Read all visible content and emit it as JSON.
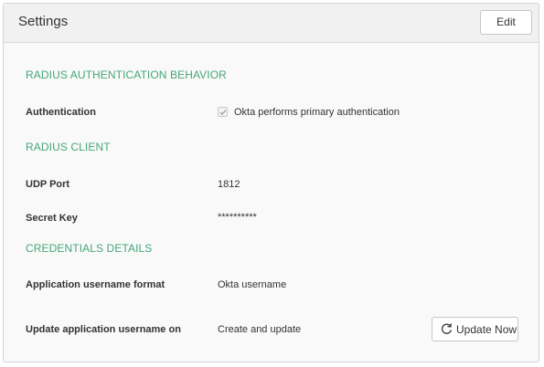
{
  "header": {
    "title": "Settings",
    "edit_label": "Edit"
  },
  "radius_auth": {
    "section_title": "RADIUS AUTHENTICATION BEHAVIOR",
    "authentication_label": "Authentication",
    "authentication_checked": true,
    "authentication_option": "Okta performs primary authentication"
  },
  "radius_client": {
    "section_title": "RADIUS CLIENT",
    "udp_port_label": "UDP Port",
    "udp_port_value": "1812",
    "secret_key_label": "Secret Key",
    "secret_key_value": "**********"
  },
  "credentials": {
    "section_title": "CREDENTIALS DETAILS",
    "username_format_label": "Application username format",
    "username_format_value": "Okta username",
    "update_on_label": "Update application username on",
    "update_on_value": "Create and update",
    "update_now_label": "Update Now",
    "update_now_icon": "refresh-icon"
  },
  "colors": {
    "accent": "#45a67a",
    "text": "#333333",
    "panel_bg": "#f9f9f9",
    "header_bg": "#f1f1f1"
  }
}
